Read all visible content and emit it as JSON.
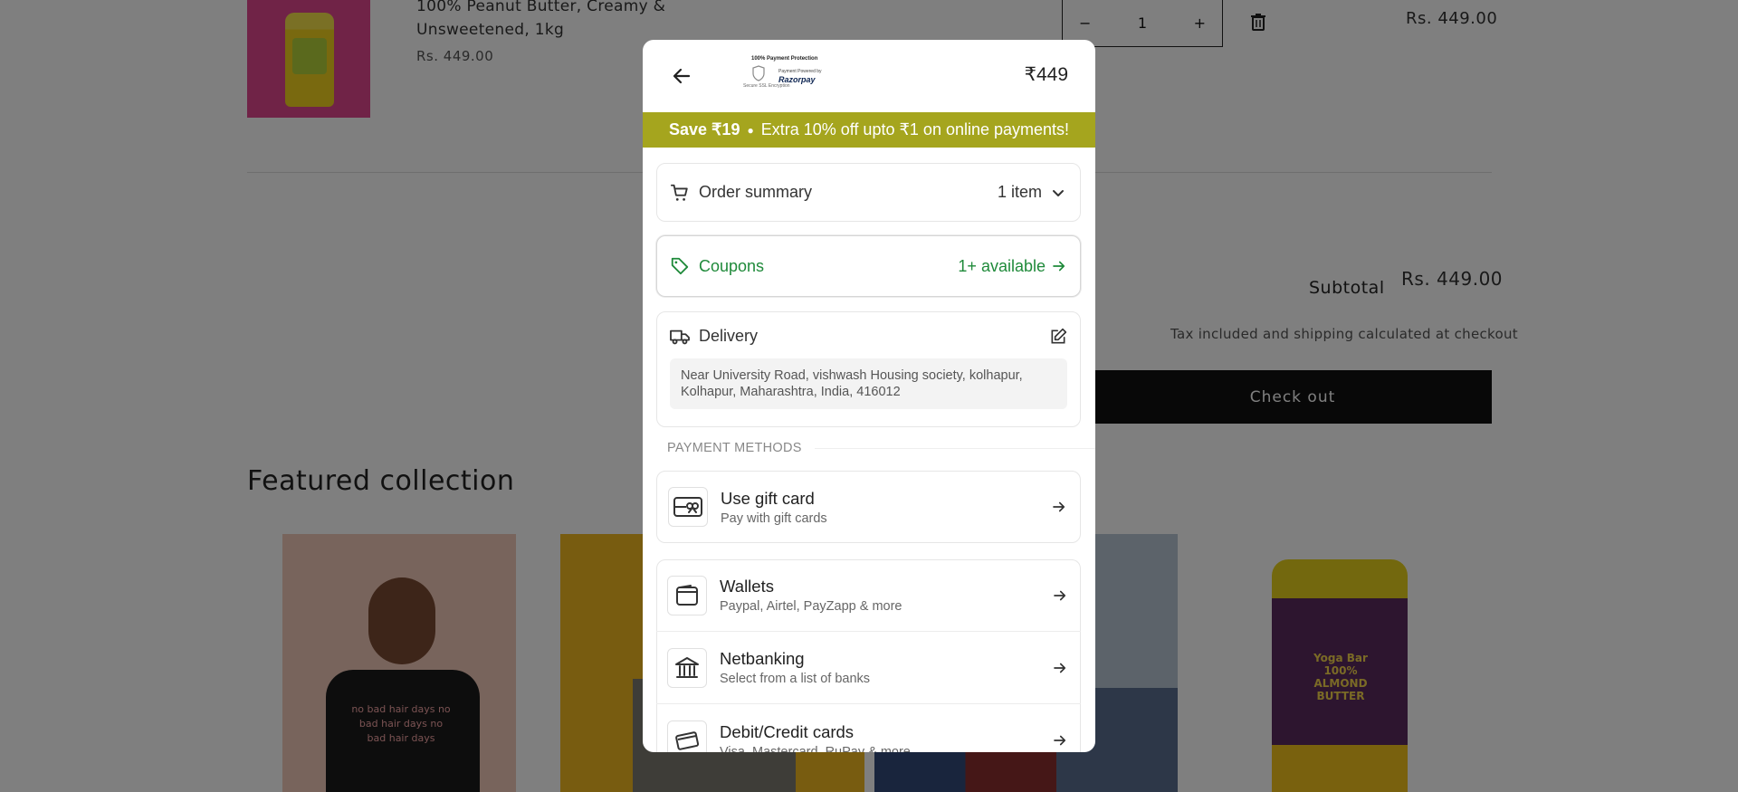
{
  "background": {
    "product": {
      "title": "100% Peanut Butter, Creamy & Unsweetened, 1kg",
      "price": "Rs. 449.00",
      "qty_minus": "−",
      "quantity": "1",
      "qty_plus": "+",
      "line_total": "Rs. 449.00"
    },
    "subtotal_label": "Subtotal",
    "subtotal_value": "Rs. 449.00",
    "tax_note": "Tax included and shipping calculated at checkout",
    "checkout_label": "Check out",
    "featured_title": "Featured collection",
    "shirt_text": "no bad hair days no bad hair days no bad hair days",
    "jar_label": "Yoga Bar 100% ALMOND BUTTER",
    "overlay_color": "#000000"
  },
  "modal": {
    "badge": {
      "title": "100% Payment Protection",
      "secure": "Secure SSL Encryption",
      "powered_by": "Payment Powered by",
      "provider": "Razorpay"
    },
    "amount": "₹449",
    "promo": {
      "save": "Save ₹19",
      "text": "Extra 10% off upto ₹1 on online payments!",
      "color": "#a5a51e"
    },
    "order_summary": {
      "label": "Order summary",
      "count": "1 item"
    },
    "coupons": {
      "label": "Coupons",
      "available": "1+ available",
      "color": "#1f8a3a"
    },
    "delivery": {
      "label": "Delivery",
      "address": "Near University Road, vishwash Housing society, kolhapur, Kolhapur, Maharashtra, India, 416012"
    },
    "payment_methods_label": "PAYMENT METHODS",
    "methods": [
      {
        "title": "Use gift card",
        "subtitle": "Pay with gift cards",
        "icon": "gift-card-icon"
      },
      {
        "title": "Wallets",
        "subtitle": "Paypal, Airtel, PayZapp & more",
        "icon": "wallet-icon"
      },
      {
        "title": "Netbanking",
        "subtitle": "Select from a list of banks",
        "icon": "bank-icon"
      },
      {
        "title": "Debit/Credit cards",
        "subtitle": "Visa, Mastercard, RuPay & more",
        "icon": "card-icon"
      }
    ]
  }
}
